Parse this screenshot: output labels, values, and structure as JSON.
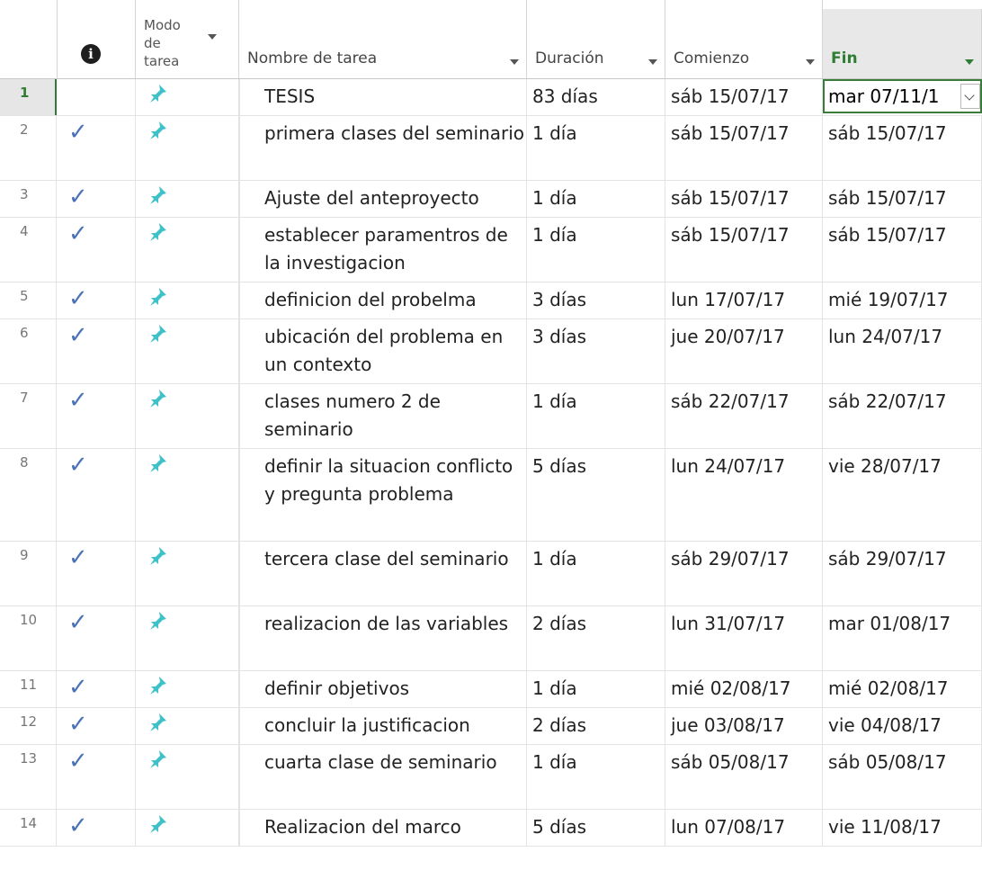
{
  "headers": {
    "info_icon": "info-icon",
    "modo": "Modo de tarea",
    "name": "Nombre de tarea",
    "duration": "Duración",
    "start": "Comienzo",
    "finish": "Fin"
  },
  "colors": {
    "check": "#4a72b6",
    "pin": "#3fc1c9",
    "active": "#2e7d32"
  },
  "rows": [
    {
      "id": "1",
      "done": false,
      "name": "TESIS",
      "duration": "83 días",
      "start": "sáb 15/07/17",
      "finish": "mar 07/11/1"
    },
    {
      "id": "2",
      "done": true,
      "name": "primera clases del seminario",
      "duration": "1 día",
      "start": "sáb 15/07/17",
      "finish": "sáb 15/07/17"
    },
    {
      "id": "3",
      "done": true,
      "name": "Ajuste del anteproyecto",
      "duration": "1 día",
      "start": "sáb 15/07/17",
      "finish": "sáb 15/07/17"
    },
    {
      "id": "4",
      "done": true,
      "name": "establecer paramentros de la investigacion",
      "duration": "1 día",
      "start": "sáb 15/07/17",
      "finish": "sáb 15/07/17"
    },
    {
      "id": "5",
      "done": true,
      "name": "definicion del probelma",
      "duration": "3 días",
      "start": "lun 17/07/17",
      "finish": "mié 19/07/17"
    },
    {
      "id": "6",
      "done": true,
      "name": "ubicación del problema en un contexto",
      "duration": "3 días",
      "start": "jue 20/07/17",
      "finish": "lun 24/07/17"
    },
    {
      "id": "7",
      "done": true,
      "name": "clases numero 2 de seminario",
      "duration": "1 día",
      "start": "sáb 22/07/17",
      "finish": "sáb 22/07/17"
    },
    {
      "id": "8",
      "done": true,
      "name": "definir la situacion conflicto y pregunta problema",
      "duration": "5 días",
      "start": "lun 24/07/17",
      "finish": "vie 28/07/17"
    },
    {
      "id": "9",
      "done": true,
      "name": "tercera clase del seminario",
      "duration": "1 día",
      "start": "sáb 29/07/17",
      "finish": "sáb 29/07/17"
    },
    {
      "id": "10",
      "done": true,
      "name": "realizacion de las variables",
      "duration": "2 días",
      "start": "lun 31/07/17",
      "finish": "mar 01/08/17"
    },
    {
      "id": "11",
      "done": true,
      "name": "definir objetivos",
      "duration": "1 día",
      "start": "mié 02/08/17",
      "finish": "mié 02/08/17"
    },
    {
      "id": "12",
      "done": true,
      "name": "concluir la justificacion",
      "duration": "2 días",
      "start": "jue 03/08/17",
      "finish": "vie 04/08/17"
    },
    {
      "id": "13",
      "done": true,
      "name": "cuarta clase de seminario",
      "duration": "1 día",
      "start": "sáb 05/08/17",
      "finish": "sáb 05/08/17"
    },
    {
      "id": "14",
      "done": true,
      "name": "Realizacion del marco",
      "duration": "5 días",
      "start": "lun 07/08/17",
      "finish": "vie 11/08/17"
    }
  ]
}
